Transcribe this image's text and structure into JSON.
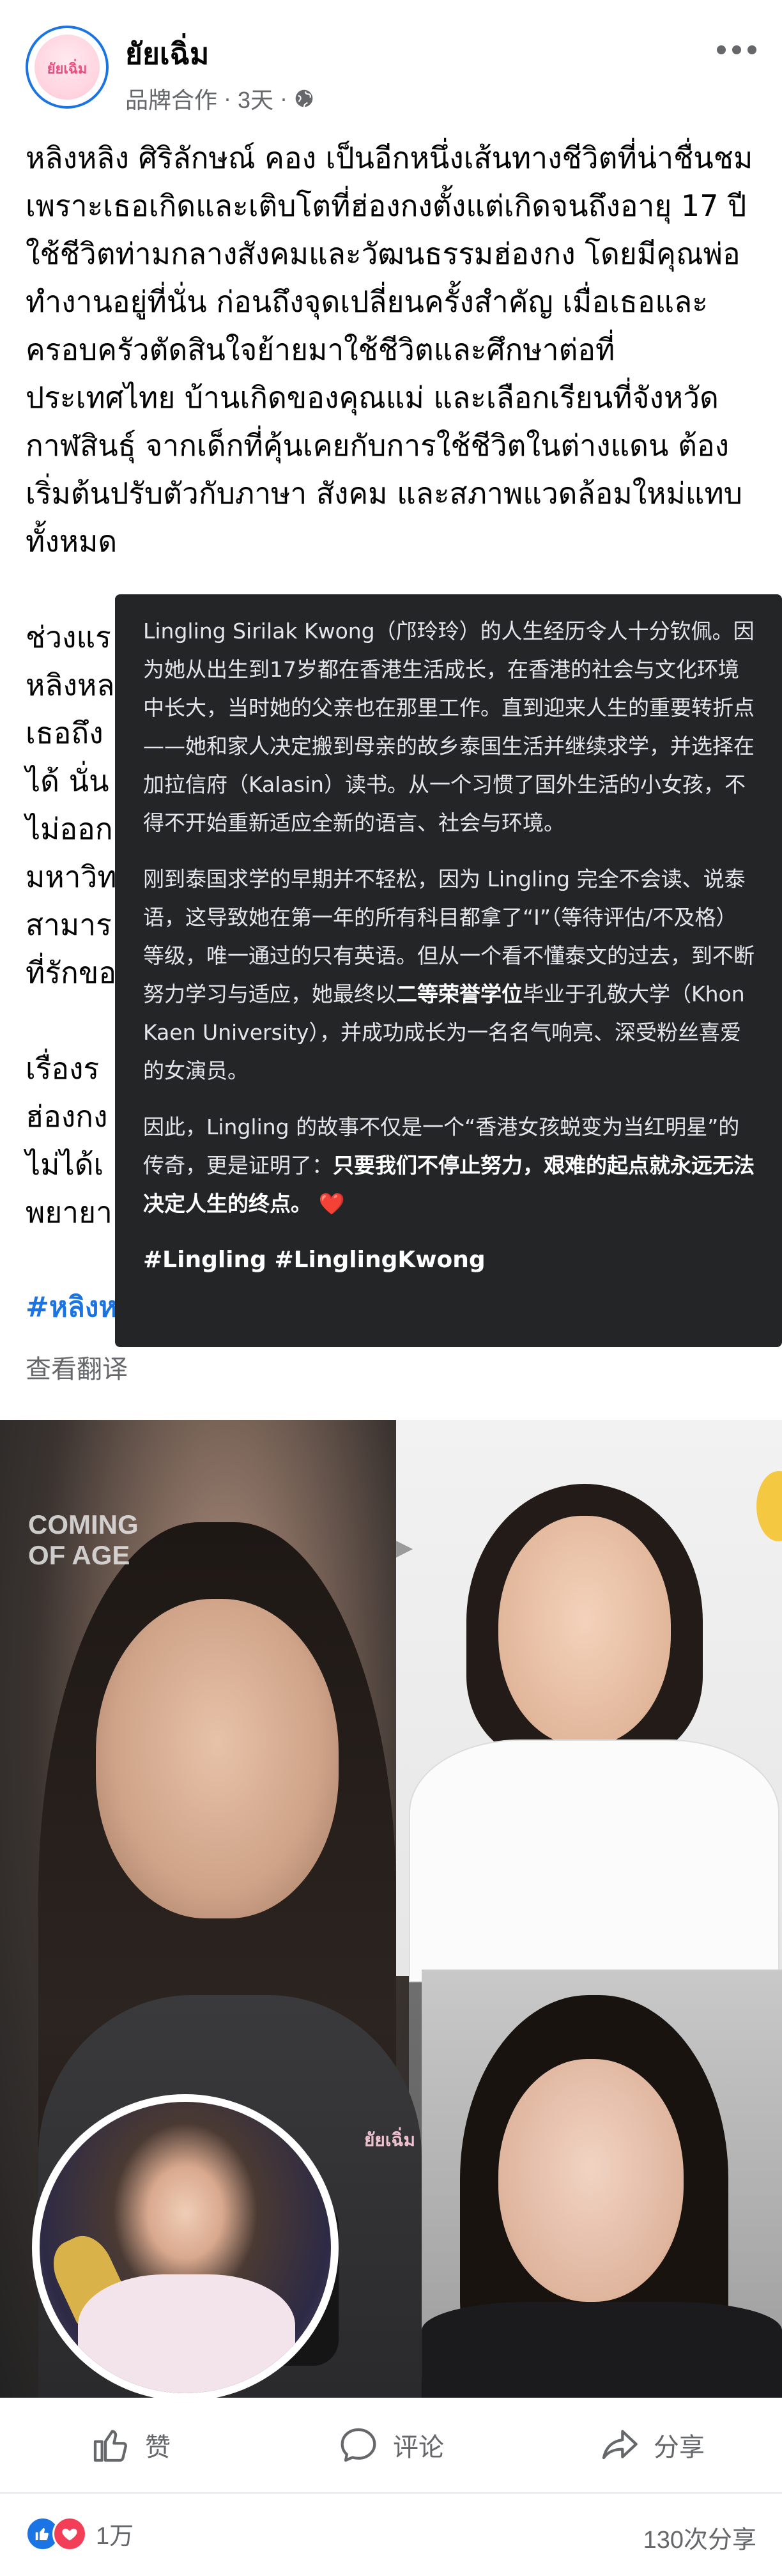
{
  "header": {
    "page_name": "ยัยเฉิ่ม",
    "avatar_logo": "ยัยเฉิ่ม",
    "meta_label": "品牌合作",
    "time": "3天",
    "more_icon": "more-horizontal-icon",
    "privacy_icon": "globe-icon"
  },
  "post": {
    "text_visible": "หลิงหลิง ศิริลักษณ์ คอง เป็นอีกหนึ่งเส้นทางชีวิตที่น่าชื่นชม เพราะเธอเกิดและเติบโตที่ฮ่องกงตั้งแต่เกิดจนถึงอายุ 17 ปี ใช้ชีวิตท่ามกลางสังคมและวัฒนธรรมฮ่องกง โดยมีคุณพ่อทำงานอยู่ที่นั่น ก่อนถึงจุดเปลี่ยนครั้งสำคัญ เมื่อเธอและครอบครัวตัดสินใจย้ายมาใช้ชีวิตและศึกษาต่อที่ประเทศไทย บ้านเกิดของคุณแม่ และเลือกเรียนที่จังหวัดกาฬสินธุ์ จากเด็กที่คุ้นเคยกับการใช้ชีวิตในต่างแดน ต้องเริ่มต้นปรับตัวกับภาษา สังคม และสภาพแวดล้อมใหม่แทบทั้งหมด",
    "text_partial": "ช่วงแร\nหลิงหล\nเธอถึง\nได้ นั่น\nไม่ออก\nมหาวิท\nสามาร\nที่รักขอ\n\n เรื่องร\nฮ่องกง\nไม่ได้เ\nพยายา",
    "hashtag_partial": "#หลิงห",
    "see_translation": "查看翻译"
  },
  "translation": {
    "p1": "Lingling Sirilak Kwong（邝玲玲）的人生经历令人十分钦佩。因为她从出生到17岁都在香港生活成长，在香港的社会与文化环境中长大，当时她的父亲也在那里工作。直到迎来人生的重要转折点——她和家人决定搬到母亲的故乡泰国生活并继续求学，并选择在加拉信府（Kalasin）读书。从一个习惯了国外生活的小女孩，不得不开始重新适应全新的语言、社会与环境。",
    "p2_a": "刚到泰国求学的早期并不轻松，因为 Lingling 完全不会读、说泰语，这导致她在第一年的所有科目都拿了“I”（等待评估/不及格）等级，唯一通过的只有英语。但从一个看不懂泰文的过去，到不断努力学习与适应，她最终以",
    "p2_bold": "二等荣誉学位",
    "p2_b": "毕业于孔敬大学（Khon Kaen University），并成功成长为一名名气响亮、深受粉丝喜爱的女演员。",
    "p3_a": "因此，Lingling 的故事不仅是一个“香港女孩蜕变为当红明星”的传奇，更是证明了：",
    "p3_bold": "只要我们不停止努力，艰难的起点就永远无法决定人生的终点。",
    "heart": "❤️",
    "tags": "#Lingling #LinglingKwong"
  },
  "photo": {
    "overlay_text_1": "COMING",
    "overlay_text_2": "OF AGE",
    "watermark": "ยัยเฉิ่ม"
  },
  "actions": {
    "like_label": "赞",
    "comment_label": "评论",
    "share_label": "分享",
    "like_icon": "thumbs-up-icon",
    "comment_icon": "comment-icon",
    "share_icon": "share-icon"
  },
  "stats": {
    "reaction_count": "1万",
    "share_count": "130次分享",
    "reaction_icons": [
      "like-reaction-icon",
      "love-reaction-icon"
    ]
  },
  "colors": {
    "link_blue": "#1b74e4",
    "tooltip_bg": "#242526",
    "secondary_text": "#65676b",
    "love_red": "#f33e58"
  }
}
